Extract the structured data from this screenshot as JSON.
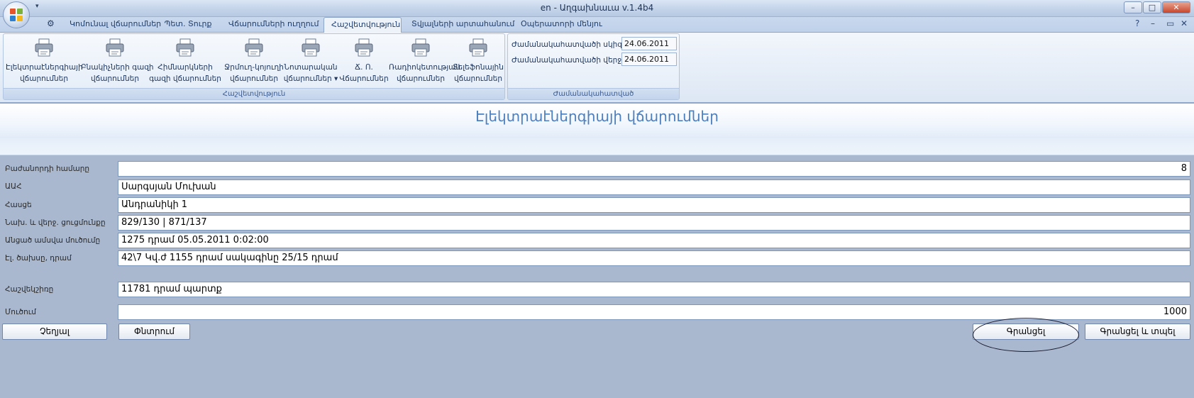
{
  "window": {
    "title": "en - Աղգախնաւա v.1.4b4",
    "minimize": "–",
    "maximize": "□",
    "close": "✕"
  },
  "tabs": [
    {
      "label": "Կոմունալ վճարումներ"
    },
    {
      "label": "Պետ. Տուրք"
    },
    {
      "label": "Վճարումների ուղղում"
    },
    {
      "label": "Հաշվետվություն"
    },
    {
      "label": "Տվյալների արտահանում"
    },
    {
      "label": "Օպերատորի մենյու"
    }
  ],
  "tab_right": {
    "help": "?",
    "min": "–",
    "restore": "▭",
    "close": "✕"
  },
  "ribbon": {
    "reports_group_caption": "Հաշվետվություն",
    "period_group_caption": "Ժամանակահատված",
    "buttons": [
      {
        "label": "Էլեկտրաէներգիայի\nվճարումներ"
      },
      {
        "label": "Բնակիչների գազի\nվճարումներ"
      },
      {
        "label": "Հիմնարկների\nգազի վճարումներ"
      },
      {
        "label": "Ջրմուղ-կոյուղի\nվճարումներ"
      },
      {
        "label": "Նոտարական\nվճարումներ ▾"
      },
      {
        "label": "Ճ. Ո.\nՎճարումներ"
      },
      {
        "label": "Ռադիոկետության\nվճարումներ"
      },
      {
        "label": "Տելեֆոնային\nվճարումներ"
      }
    ],
    "period": {
      "start_label": "Ժամանակահատվածի սկիզբ",
      "start_value": "24.06.2011",
      "end_label": "Ժամանակահատվածի վերջ",
      "end_value": "24.06.2011"
    }
  },
  "page": {
    "title": "Էլեկտրաէներգիայի վճարումներ"
  },
  "form": {
    "subscriber_label": "Բաժանորդի համարը",
    "subscriber_value": "8",
    "name_label": "ԱԱՀ",
    "name_value": "Սարգսյան Մուխան",
    "address_label": "Հասցե",
    "address_value": "Անդրանիկի 1",
    "readings_label": "Նախ. և վերջ. ցուցմունքը",
    "readings_value": "829/130 | 871/137",
    "last_payment_label": "Անցած ամսվա մուծումը",
    "last_payment_value": "1275 դրամ 05.05.2011 0:02:00",
    "consumption_label": "Էլ. ծախսը, դրամ",
    "consumption_value": "42\\7 Կվ.ժ 1155 դրամ սակագինը 25/15 դրամ",
    "balance_label": "Հաշվեկշիռը",
    "balance_value": "11781 դրամ պարտք",
    "payment_label": "Մուծում",
    "payment_value": "1000"
  },
  "buttons": {
    "cancel": "Չեղյալ",
    "search": "Փնտրում",
    "record": "Գրանցել",
    "record_print": "Գրանցել և տպել"
  },
  "colors": {
    "accent": "#4e7fbd",
    "background": "#a9b8cf",
    "ribbon": "#dde7f4"
  }
}
